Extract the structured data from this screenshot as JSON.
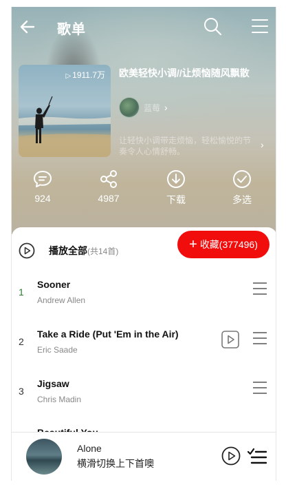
{
  "header": {
    "title": "歌单"
  },
  "playlist": {
    "play_count": "1911.7万",
    "name": "欧美轻快小调//让烦恼随风飘散",
    "creator_name": "蓝莓",
    "description": "让轻快小调带走烦恼，轻松愉悦的节奏令人心情舒畅。"
  },
  "actions": {
    "comment_count": "924",
    "share_count": "4987",
    "download_label": "下载",
    "multiselect_label": "多选"
  },
  "list_header": {
    "play_all_label": "播放全部",
    "play_all_count": "(共14首)",
    "collect_label": "收藏(377496)"
  },
  "songs": [
    {
      "index": "1",
      "title": "Sooner",
      "artist": "Andrew Allen",
      "has_mv": false,
      "index_color": "#2e7d32"
    },
    {
      "index": "2",
      "title": "Take a Ride (Put 'Em in the Air)",
      "artist": "Eric Saade",
      "has_mv": true,
      "index_color": "#333333"
    },
    {
      "index": "3",
      "title": "Jigsaw",
      "artist": "Chris Madin",
      "has_mv": false,
      "index_color": "#333333"
    },
    {
      "index": "",
      "title": "Beautiful You",
      "artist": "",
      "has_mv": false,
      "index_color": "#333333"
    }
  ],
  "mini_player": {
    "title": "Alone",
    "hint": "横滑切换上下首噢"
  },
  "colors": {
    "accent_red": "#f20d0d",
    "first_index_green": "#2e7d32"
  },
  "icons": {
    "back": "arrow-left-icon",
    "search": "search-icon",
    "menu": "hamburger-menu-icon",
    "comment": "comment-icon",
    "share": "share-icon",
    "download": "download-icon",
    "multiselect": "check-circle-icon",
    "play": "play-circle-icon",
    "more": "more-lines-icon",
    "playlist": "playlist-queue-icon"
  }
}
